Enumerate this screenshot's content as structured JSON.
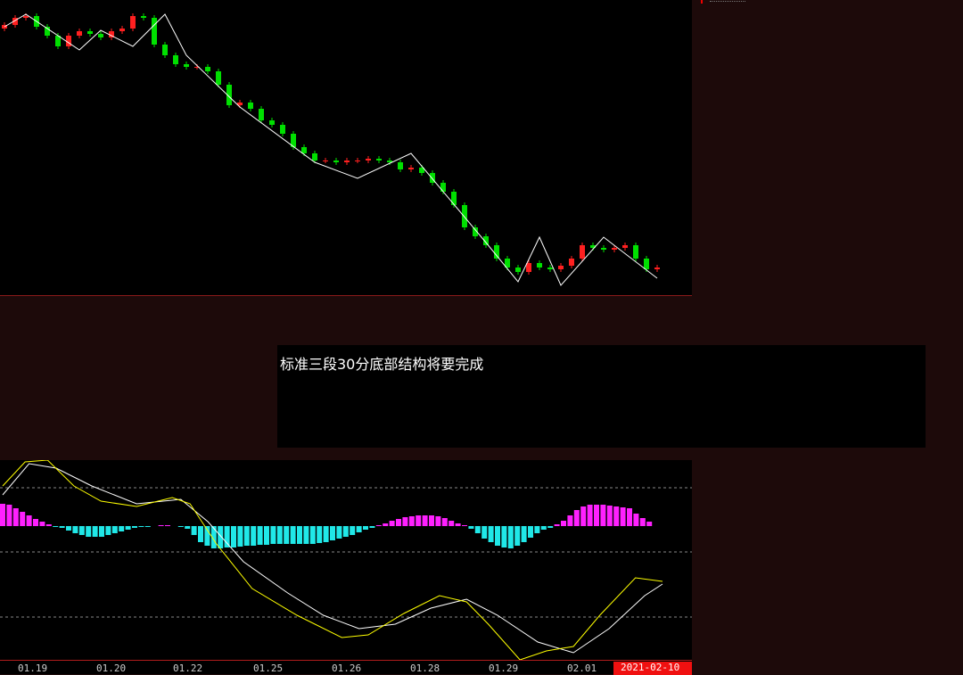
{
  "note": "标准三段30分底部结构将要完成",
  "axis": {
    "ticks": [
      "01.19",
      "01.20",
      "01.22",
      "01.25",
      "01.26",
      "01.28",
      "01.29",
      "02.01"
    ],
    "current_date": "2021-02-10"
  },
  "colors": {
    "up": "#ff2020",
    "down": "#00e000",
    "zigzag": "#ffffff",
    "macd_pos": "#ff20ff",
    "macd_neg": "#20e8e8",
    "dif": "#ffff00",
    "dea": "#ffffff"
  },
  "chart_data": [
    {
      "type": "candlestick",
      "title": "",
      "closes": [
        302,
        310,
        312,
        300,
        290,
        278,
        290,
        295,
        292,
        288,
        295,
        298,
        312,
        310,
        280,
        268,
        258,
        255,
        255,
        250,
        235,
        212,
        215,
        208,
        195,
        190,
        180,
        165,
        158,
        150,
        150,
        148,
        150,
        150,
        152,
        150,
        148,
        140,
        142,
        136,
        125,
        115,
        100,
        75,
        65,
        55,
        40,
        30,
        25,
        35,
        30,
        28,
        32,
        40,
        55,
        52,
        50,
        52,
        55,
        40,
        28,
        30
      ],
      "zigzag": [
        [
          0,
          300
        ],
        [
          2,
          314
        ],
        [
          7,
          274
        ],
        [
          9,
          296
        ],
        [
          12,
          278
        ],
        [
          15,
          314
        ],
        [
          17,
          268
        ],
        [
          22,
          210
        ],
        [
          29,
          148
        ],
        [
          33,
          130
        ],
        [
          38,
          158
        ],
        [
          45,
          58
        ],
        [
          48,
          14
        ],
        [
          50,
          64
        ],
        [
          52,
          10
        ],
        [
          56,
          64
        ],
        [
          61,
          18
        ]
      ]
    },
    {
      "type": "bar+line",
      "title": "MACD",
      "histogram": [
        25,
        24,
        20,
        16,
        12,
        8,
        5,
        2,
        -1,
        -2,
        -5,
        -8,
        -10,
        -12,
        -12,
        -12,
        -10,
        -8,
        -6,
        -4,
        -2,
        -1,
        -1,
        0,
        1,
        1,
        0,
        -1,
        -3,
        -10,
        -18,
        -22,
        -25,
        -25,
        -24,
        -24,
        -23,
        -22,
        -22,
        -21,
        -21,
        -20,
        -20,
        -20,
        -20,
        -20,
        -20,
        -20,
        -19,
        -18,
        -16,
        -14,
        -12,
        -10,
        -7,
        -4,
        -2,
        1,
        3,
        6,
        8,
        10,
        11,
        12,
        12,
        12,
        11,
        9,
        6,
        3,
        1,
        -3,
        -8,
        -14,
        -18,
        -22,
        -24,
        -25,
        -22,
        -18,
        -13,
        -8,
        -4,
        -2,
        2,
        6,
        12,
        18,
        22,
        24,
        24,
        24,
        23,
        22,
        21,
        20,
        14,
        9,
        5
      ],
      "dif": [
        [
          0,
          45
        ],
        [
          3.4,
          72
        ],
        [
          6.8,
          74
        ],
        [
          10.8,
          45
        ],
        [
          14.9,
          28
        ],
        [
          20.3,
          22
        ],
        [
          25.7,
          32
        ],
        [
          28.4,
          25
        ],
        [
          32.4,
          -20
        ],
        [
          37.8,
          -70
        ],
        [
          44.6,
          -100
        ],
        [
          51.4,
          -125
        ],
        [
          55.4,
          -122
        ],
        [
          60.8,
          -98
        ],
        [
          66.2,
          -78
        ],
        [
          70.3,
          -85
        ],
        [
          73.6,
          -110
        ],
        [
          78.4,
          -150
        ],
        [
          82.4,
          -140
        ],
        [
          86.5,
          -135
        ],
        [
          90.5,
          -100
        ],
        [
          95.9,
          -58
        ],
        [
          100,
          -62
        ]
      ],
      "dea": [
        [
          0,
          35
        ],
        [
          4,
          70
        ],
        [
          8.1,
          65
        ],
        [
          13.5,
          45
        ],
        [
          20.3,
          25
        ],
        [
          27,
          30
        ],
        [
          31.1,
          5
        ],
        [
          36.5,
          -40
        ],
        [
          43.2,
          -75
        ],
        [
          48.6,
          -100
        ],
        [
          54,
          -115
        ],
        [
          59.5,
          -110
        ],
        [
          64.9,
          -92
        ],
        [
          70.3,
          -82
        ],
        [
          75,
          -100
        ],
        [
          81.1,
          -130
        ],
        [
          86.5,
          -142
        ],
        [
          91.9,
          -115
        ],
        [
          97.3,
          -78
        ],
        [
          100,
          -65
        ]
      ],
      "reference_levels": [
        43,
        0,
        -29,
        -102
      ]
    }
  ]
}
